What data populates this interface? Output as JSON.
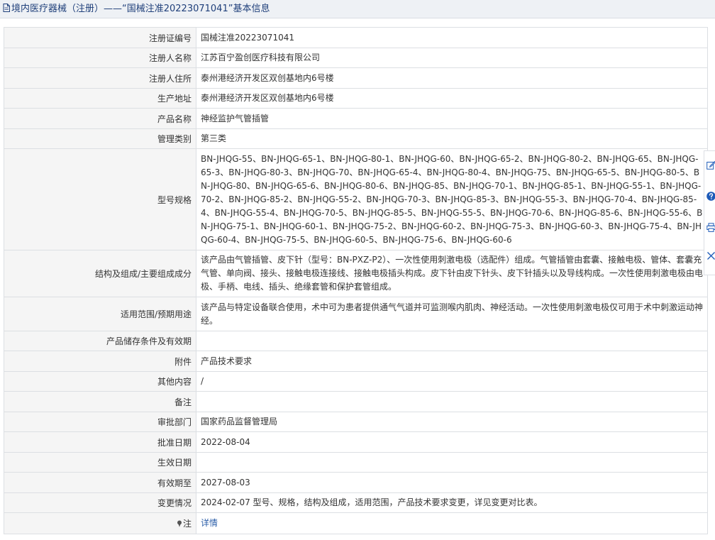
{
  "header": {
    "title": "境内医疗器械（注册）——“国械注准20223071041”基本信息",
    "icon": "document-icon"
  },
  "rows": [
    {
      "label": "注册证编号",
      "value": "国械注准20223071041"
    },
    {
      "label": "注册人名称",
      "value": "江苏百宁盈创医疗科技有限公司"
    },
    {
      "label": "注册人住所",
      "value": "泰州港经济开发区双创基地内6号楼"
    },
    {
      "label": "生产地址",
      "value": "泰州港经济开发区双创基地内6号楼"
    },
    {
      "label": "产品名称",
      "value": "神经监护气管插管"
    },
    {
      "label": "管理类别",
      "value": "第三类"
    },
    {
      "label": "型号规格",
      "value": "BN-JHQG-55、BN-JHQG-65-1、BN-JHQG-80-1、BN-JHQG-60、BN-JHQG-65-2、BN-JHQG-80-2、BN-JHQG-65、BN-JHQG-65-3、BN-JHQG-80-3、BN-JHQG-70、BN-JHQG-65-4、BN-JHQG-80-4、BN-JHQG-75、BN-JHQG-65-5、BN-JHQG-80-5、BN-JHQG-80、BN-JHQG-65-6、BN-JHQG-80-6、BN-JHQG-85、BN-JHQG-70-1、BN-JHQG-85-1、BN-JHQG-55-1、BN-JHQG-70-2、BN-JHQG-85-2、BN-JHQG-55-2、BN-JHQG-70-3、BN-JHQG-85-3、BN-JHQG-55-3、BN-JHQG-70-4、BN-JHQG-85-4、BN-JHQG-55-4、BN-JHQG-70-5、BN-JHQG-85-5、BN-JHQG-55-5、BN-JHQG-70-6、BN-JHQG-85-6、BN-JHQG-55-6、BN-JHQG-75-1、BN-JHQG-60-1、BN-JHQG-75-2、BN-JHQG-60-2、BN-JHQG-75-3、BN-JHQG-60-3、BN-JHQG-75-4、BN-JHQG-60-4、BN-JHQG-75-5、BN-JHQG-60-5、BN-JHQG-75-6、BN-JHQG-60-6"
    },
    {
      "label": "结构及组成/主要组成成分",
      "value": "该产品由气管插管、皮下针（型号：BN-PXZ-P2）、一次性使用刺激电极（选配件）组成。气管插管由套囊、接触电极、管体、套囊充气管、单向阀、接头、接触电极连接线、接触电极插头构成。皮下针由皮下针头、皮下针插头以及导线构成。一次性使用刺激电极由电极、手柄、电线、插头、绝缘套管和保护套管组成。"
    },
    {
      "label": "适用范围/预期用途",
      "value": "该产品与特定设备联合使用，术中可为患者提供通气气道并可监测喉内肌肉、神经活动。一次性使用刺激电极仅可用于术中刺激运动神经。"
    },
    {
      "label": "产品储存条件及有效期",
      "value": ""
    },
    {
      "label": "附件",
      "value": "产品技术要求"
    },
    {
      "label": "其他内容",
      "value": "/"
    },
    {
      "label": "备注",
      "value": ""
    },
    {
      "label": "审批部门",
      "value": "国家药品监督管理局"
    },
    {
      "label": "批准日期",
      "value": "2022-08-04"
    },
    {
      "label": "生效日期",
      "value": ""
    },
    {
      "label": "有效期至",
      "value": "2027-08-03"
    },
    {
      "label": "变更情况",
      "value": "2024-02-07 型号、规格，结构及组成，适用范围，产品技术要求变更，详见变更对比表。"
    }
  ],
  "note": {
    "label": "注",
    "link": "详情",
    "icon": "pin-icon"
  },
  "side_tools": [
    "edit-icon",
    "help-icon",
    "print-icon",
    "close-icon"
  ],
  "colors": {
    "title": "#1f3f7a",
    "link": "#2b5ea8",
    "label_bg": "#f5f5f5",
    "border": "#dcdfe3",
    "help": "#1e5bb8"
  }
}
